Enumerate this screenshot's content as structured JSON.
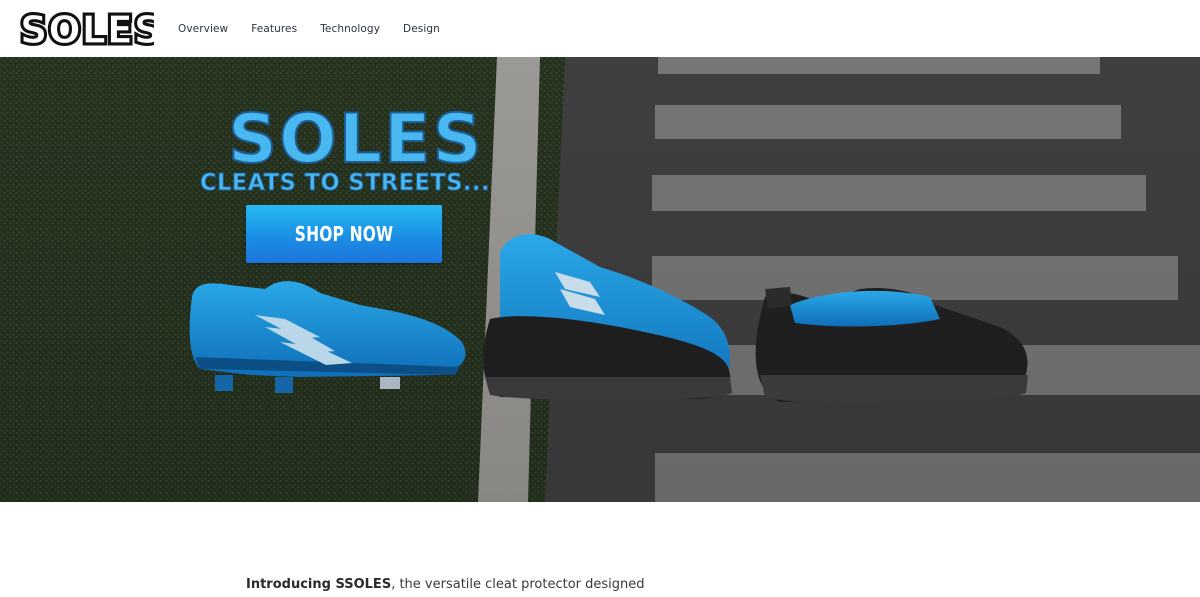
{
  "brand": {
    "logo_text": "SOLES"
  },
  "nav": {
    "items": [
      {
        "label": "Overview"
      },
      {
        "label": "Features"
      },
      {
        "label": "Technology"
      },
      {
        "label": "Design"
      }
    ]
  },
  "hero": {
    "title": "SOLES",
    "tagline": "CLEATS TO STREETS...",
    "cta_label": "SHOP NOW",
    "accent_color": "#1e90ea"
  },
  "intro": {
    "bold": "Introducing SSOLES",
    "text": ", the versatile cleat protector designed"
  }
}
